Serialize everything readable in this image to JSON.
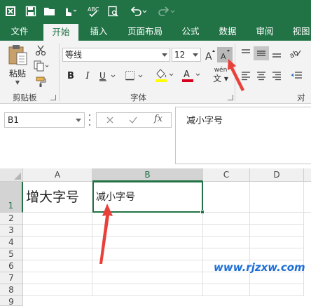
{
  "tabs": [
    {
      "label": "文件",
      "active": false
    },
    {
      "label": "开始",
      "active": true
    },
    {
      "label": "插入",
      "active": false
    },
    {
      "label": "页面布局",
      "active": false
    },
    {
      "label": "公式",
      "active": false
    },
    {
      "label": "数据",
      "active": false
    },
    {
      "label": "审阅",
      "active": false
    },
    {
      "label": "视图",
      "active": false
    }
  ],
  "clipboard": {
    "paste_label": "粘贴",
    "group_label": "剪贴板"
  },
  "font": {
    "name": "等线",
    "size": "12",
    "group_label": "字体",
    "phonetic_label": "wén"
  },
  "alignment": {
    "group_label": "对齐"
  },
  "name_box": "B1",
  "formula": "减小字号",
  "columns": [
    "A",
    "B",
    "C",
    "D"
  ],
  "rows": [
    "1",
    "2",
    "3",
    "4",
    "5",
    "6",
    "7",
    "8",
    "9"
  ],
  "cells": {
    "A1": "增大字号",
    "B1": "减小字号"
  },
  "selected_cell": "B1",
  "watermark": "www.rjzxw.com",
  "colors": {
    "excel_green": "#217346",
    "arrow_red": "#e8413a",
    "font_color_red": "#d6001c",
    "fill_yellow": "#ffff00"
  }
}
